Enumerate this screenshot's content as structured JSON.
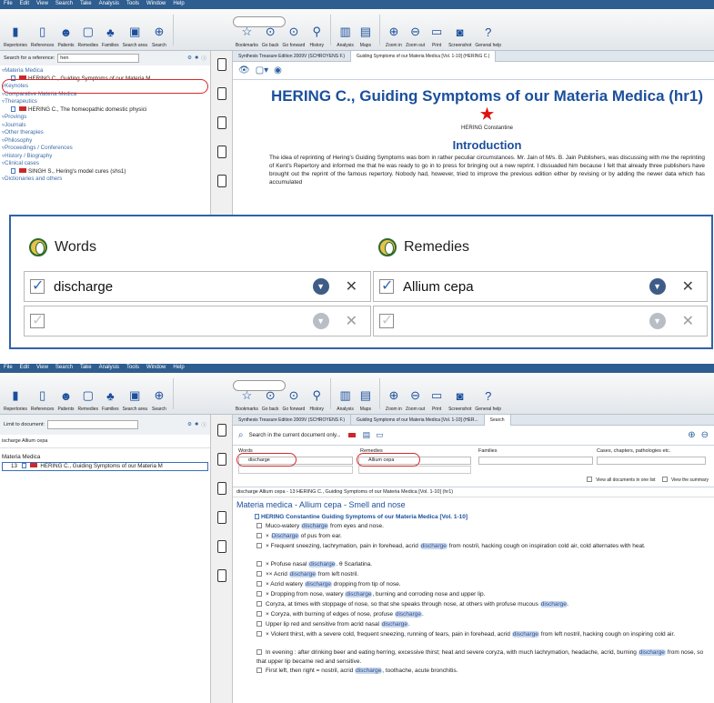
{
  "top": {
    "menu": [
      "File",
      "Edit",
      "View",
      "Search",
      "Take",
      "Analysis",
      "Tools",
      "Window",
      "Help"
    ],
    "toolbar": [
      "Repertories",
      "References",
      "Patients",
      "Remedies",
      "Families",
      "Search area",
      "Search",
      "Bookmarks",
      "Go back",
      "Go forward",
      "History",
      "Analysis",
      "Maps",
      "Zoom in",
      "Zoom out",
      "Print",
      "Screenshot",
      "General help"
    ],
    "search_label": "Search for a reference:",
    "search_value": "hen",
    "tree": [
      {
        "label": "Materia Medica",
        "type": "h"
      },
      {
        "label": "HERING C., Guiding Symptoms of our Materia M",
        "type": "sub"
      },
      {
        "label": "Keynotes",
        "type": "h"
      },
      {
        "label": "Comparative Materia Medica",
        "type": "h"
      },
      {
        "label": "Therapeutics",
        "type": "h"
      },
      {
        "label": "HERING C., The homeopathic domestic physici",
        "type": "sub"
      },
      {
        "label": "Provings",
        "type": "h"
      },
      {
        "label": "Journals",
        "type": "h"
      },
      {
        "label": "Other therapies",
        "type": "h"
      },
      {
        "label": "Philosophy",
        "type": "h"
      },
      {
        "label": "Proceedings / Conferences",
        "type": "h"
      },
      {
        "label": "History / Biography",
        "type": "h"
      },
      {
        "label": "Clinical cases",
        "type": "h"
      },
      {
        "label": "SINGH S., Hering's model cures (shs1)",
        "type": "sub"
      },
      {
        "label": "Dictionaries and others",
        "type": "h"
      }
    ],
    "tabs": [
      "Synthesis Treasure Edition 2009V (SCHROYENS F.)",
      "Guiding Symptoms of our Materia Medica [Vol. 1-10] (HERING C.)"
    ],
    "doc_title": "HERING C., Guiding Symptoms of our Materia Medica (hr1)",
    "doc_author": "HERING Constantine",
    "intro_heading": "Introduction",
    "intro_text": "The idea of reprinting of Hering's Guiding Symptoms was born in rather peculiar circumstances. Mr. Jain of M/s. B. Jain Publishers, was discussing with me the reprinting of Kent's Repertory and informed me that he was ready to go in to press for bringing out a new reprint. I dissuaded him because I felt that already three publishers have brought out the reprint of the famous repertory. Nobody had, however, tried to improve the previous edition either by revising or by adding the newer data which has accumulated"
  },
  "overlay": {
    "words_label": "Words",
    "remedies_label": "Remedies",
    "words_value": "discharge",
    "remedies_value": "Allium cepa"
  },
  "bottom": {
    "menu": [
      "File",
      "Edit",
      "View",
      "Search",
      "Take",
      "Analysis",
      "Tools",
      "Window",
      "Help"
    ],
    "limit_label": "Limit to document:",
    "breadcrumb": "ischarge Allium cepa",
    "tree_head": "Materia Medica",
    "tree_item_count": "13",
    "tree_item": "HERING C., Guiding Symptoms of our Materia M",
    "tabs": [
      "Synthesis Treasure Edition 2009V (SCHROYENS F.)",
      "Guiding Symptoms of our Materia Medica [Vol. 1-10] (HER...",
      "Search"
    ],
    "search_scope": "Search in the current document only...",
    "cols": [
      "Words",
      "Remedies",
      "Families",
      "Cases, chapters, pathologies etc."
    ],
    "words_value": "discharge",
    "remedies_value": "Allium cepa",
    "view_all": "View all documents in one list",
    "view_summary": "View the summary",
    "result_header": "discharge Allium cepa - 13   HERING C., Guiding Symptoms of our Materia Medica [Vol. 1-10] (hr1)",
    "result_title": "Materia medica - Allium cepa - Smell and nose",
    "result_source": "HERING Constantine Guiding Symptoms of our Materia Medica [Vol. 1-10]",
    "results": [
      [
        "Muco-watery ",
        "discharge",
        " from eyes and nose."
      ],
      [
        "× ",
        "Discharge",
        " of pus from ear."
      ],
      [
        "× Frequent sneezing, lachrymation, pain in forehead, acrid ",
        "discharge",
        " from nostril, hacking cough on inspiration cold air, cold alternates with heat."
      ],
      [
        "× Profuse nasal ",
        "discharge",
        ". θ Scarlatina."
      ],
      [
        "×× Acrid ",
        "discharge",
        " from left nostril."
      ],
      [
        "× Acrid watery ",
        "discharge",
        " dropping from tip of nose."
      ],
      [
        "× Dropping from nose, watery ",
        "discharge",
        ", burning and corroding nose and upper lip."
      ],
      [
        "Coryza, at times with stoppage of nose, so that she speaks through nose, at others with profuse mucous ",
        "discharge",
        "."
      ],
      [
        "× Coryza, with burning of edges of nose, profuse ",
        "discharge",
        "."
      ],
      [
        "Upper lip red and sensitive from acrid nasal ",
        "discharge",
        "."
      ],
      [
        "× Violent thirst, with a severe cold, frequent sneezing, running of tears, pain in forehead, acrid ",
        "discharge",
        " from left nostril, hacking cough on inspiring cold air."
      ],
      [
        "In evening : after drinking beer and eating herring, excessive thirst; heat and severe coryza, with much lachrymation, headache, acrid, burning ",
        "discharge",
        " from nose, so that upper lip became red and sensitive."
      ],
      [
        "First left, then right = nostril, acrid ",
        "discharge",
        ", toothache, acute bronchitis."
      ]
    ]
  }
}
